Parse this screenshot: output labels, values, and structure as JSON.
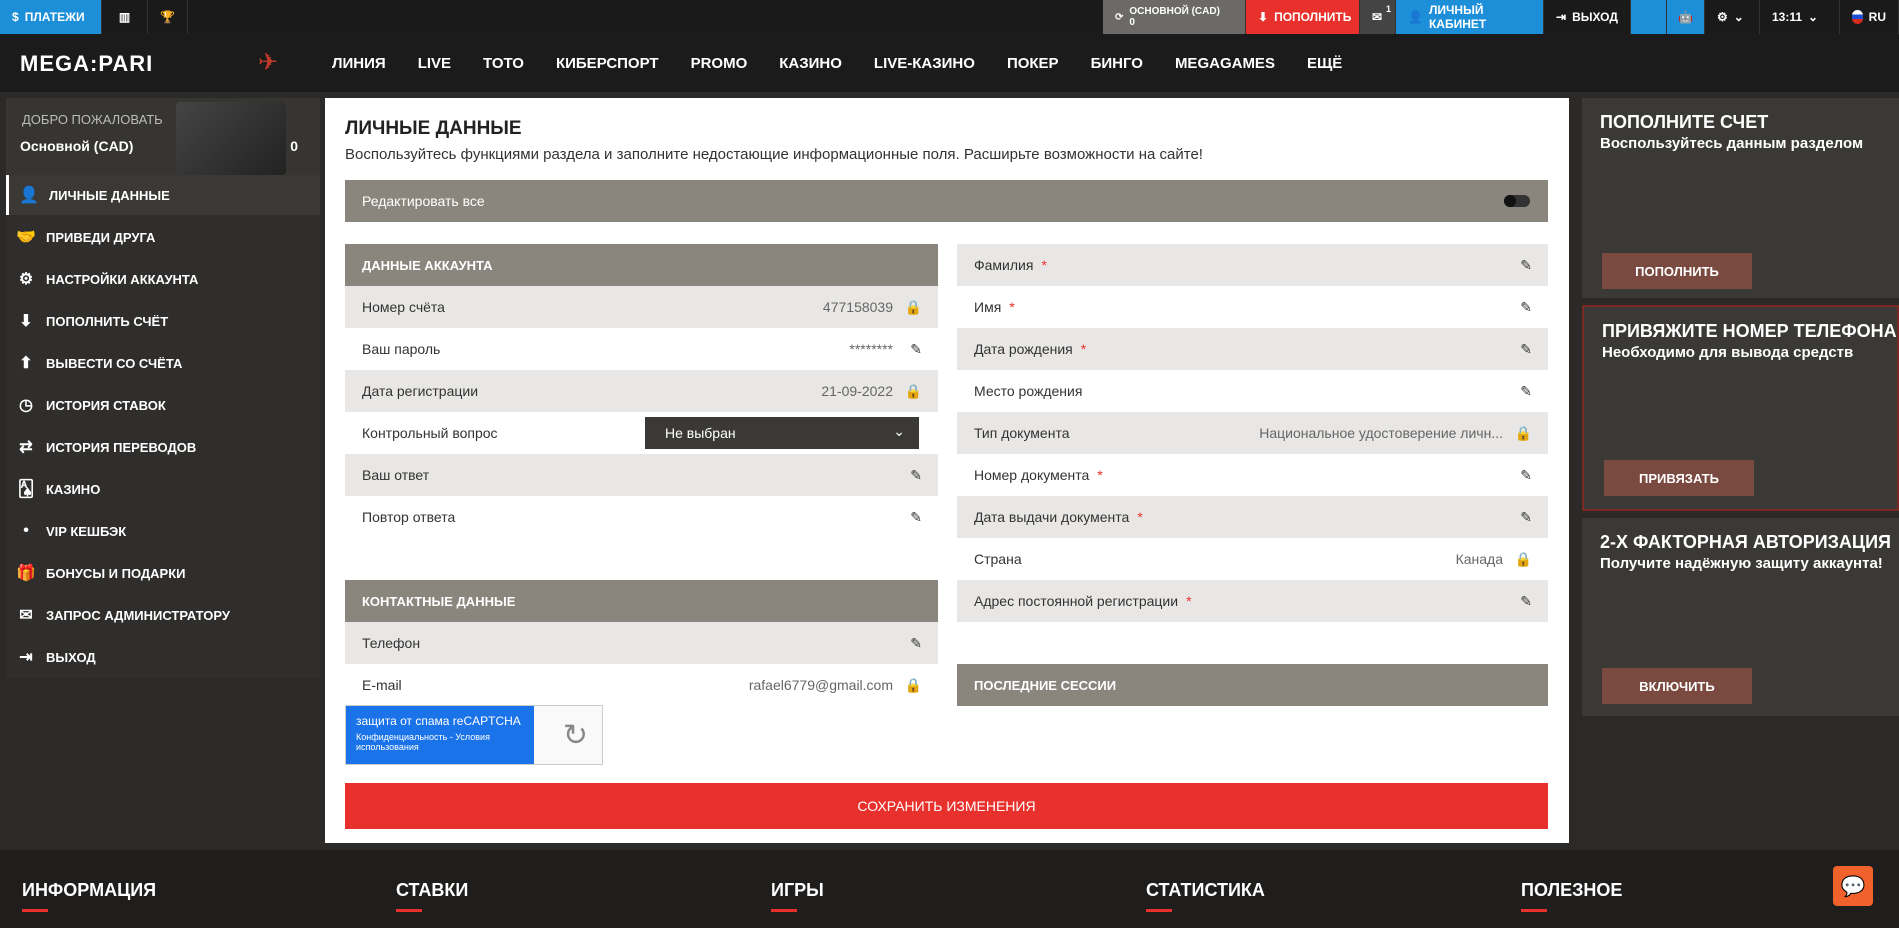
{
  "topbar": {
    "payments": "ПЛАТЕЖИ",
    "account": "ОСНОВНОЙ (CAD)",
    "balance": "0",
    "deposit": "ПОПОЛНИТЬ",
    "mail_count": "1",
    "cabinet": "ЛИЧНЫЙ КАБИНЕТ",
    "logout": "ВЫХОД",
    "time": "13:11",
    "lang": "RU"
  },
  "nav": {
    "logo": "MEGA:PARI",
    "items": [
      "ЛИНИЯ",
      "LIVE",
      "ТОТО",
      "КИБЕРСПОРТ",
      "PROMO",
      "КАЗИНО",
      "LIVE-КАЗИНО",
      "ПОКЕР",
      "БИНГО",
      "MEGAGAMES",
      "ЕЩЁ"
    ]
  },
  "sidebar": {
    "welcome": "ДОБРО ПОЖАЛОВАТЬ",
    "account": "Основной (CAD)",
    "balance": "0",
    "items": [
      {
        "label": "ЛИЧНЫЕ ДАННЫЕ",
        "icon": "user-icon"
      },
      {
        "label": "ПРИВЕДИ ДРУГА",
        "icon": "handshake-icon"
      },
      {
        "label": "НАСТРОЙКИ АККАУНТА",
        "icon": "gears-icon"
      },
      {
        "label": "ПОПОЛНИТЬ СЧЁТ",
        "icon": "download-icon"
      },
      {
        "label": "ВЫВЕСТИ СО СЧЁТА",
        "icon": "upload-icon"
      },
      {
        "label": "ИСТОРИЯ СТАВОК",
        "icon": "clock-icon"
      },
      {
        "label": "ИСТОРИЯ ПЕРЕВОДОВ",
        "icon": "transfer-icon"
      },
      {
        "label": "КАЗИНО",
        "icon": "cards-icon"
      },
      {
        "label": "VIP КЕШБЭК",
        "icon": "dot-icon"
      },
      {
        "label": "БОНУСЫ И ПОДАРКИ",
        "icon": "gift-icon"
      },
      {
        "label": "ЗАПРОС АДМИНИСТРАТОРУ",
        "icon": "mail-icon"
      },
      {
        "label": "ВЫХОД",
        "icon": "exit-icon"
      }
    ]
  },
  "main": {
    "title": "ЛИЧНЫЕ ДАННЫЕ",
    "subtitle": "Воспользуйтесь функциями раздела и заполните недостающие информационные поля. Расширьте возможности на сайте!",
    "edit_all": "Редактировать все",
    "account_header": "ДАННЫЕ АККАУНТА",
    "account_rows": [
      {
        "label": "Номер счёта",
        "value": "477158039",
        "icon": "lock-icon"
      },
      {
        "label": "Ваш пароль",
        "value": "********",
        "icon": "pencil-icon"
      },
      {
        "label": "Дата регистрации",
        "value": "21-09-2022",
        "icon": "lock-icon"
      }
    ],
    "security_question_label": "Контрольный вопрос",
    "security_question_value": "Не выбран",
    "answer_rows": [
      {
        "label": "Ваш ответ"
      },
      {
        "label": "Повтор ответа"
      }
    ],
    "contact_header": "КОНТАКТНЫЕ ДАННЫЕ",
    "contact_rows": [
      {
        "label": "Телефон",
        "value": ""
      },
      {
        "label": "E-mail",
        "value": "rafael6779@gmail.com"
      }
    ],
    "personal_rows": [
      {
        "label": "Фамилия",
        "req": "*",
        "value": "",
        "icon": "pencil"
      },
      {
        "label": "Имя",
        "req": "*",
        "value": "",
        "icon": "pencil"
      },
      {
        "label": "Дата рождения",
        "req": "*",
        "value": "",
        "icon": "pencil"
      },
      {
        "label": "Место рождения",
        "req": "",
        "value": "",
        "icon": "pencil"
      },
      {
        "label": "Тип документа",
        "req": "",
        "value": "Национальное удостоверение личн...",
        "icon": "lock"
      },
      {
        "label": "Номер документа",
        "req": "*",
        "value": "",
        "icon": "pencil"
      },
      {
        "label": "Дата выдачи документа",
        "req": "*",
        "value": "",
        "icon": "pencil"
      },
      {
        "label": "Страна",
        "req": "",
        "value": "Канада",
        "icon": "lock"
      },
      {
        "label": "Адрес постоянной регистрации",
        "req": "*",
        "value": "",
        "icon": "pencil"
      }
    ],
    "sessions_header": "ПОСЛЕДНИЕ СЕССИИ",
    "recaptcha_title": "защита от спама reCAPTCHA",
    "recaptcha_links": "Конфиденциальность - Условия использования",
    "save": "СОХРАНИТЬ ИЗМЕНЕНИЯ"
  },
  "promos": [
    {
      "title": "ПОПОЛНИТЕ СЧЕТ",
      "text": "Воспользуйтесь данным разделом",
      "button": "ПОПОЛНИТЬ"
    },
    {
      "title": "ПРИВЯЖИТЕ НОМЕР ТЕЛЕФОНА",
      "text": "Необходимо для вывода средств",
      "button": "ПРИВЯЗАТЬ"
    },
    {
      "title": "2-Х ФАКТОРНАЯ АВТОРИЗАЦИЯ",
      "text": "Получите надёжную защиту аккаунта!",
      "button": "ВКЛЮЧИТЬ"
    }
  ],
  "footer": [
    "ИНФОРМАЦИЯ",
    "СТАВКИ",
    "ИГРЫ",
    "СТАТИСТИКА",
    "ПОЛЕЗНОЕ"
  ]
}
